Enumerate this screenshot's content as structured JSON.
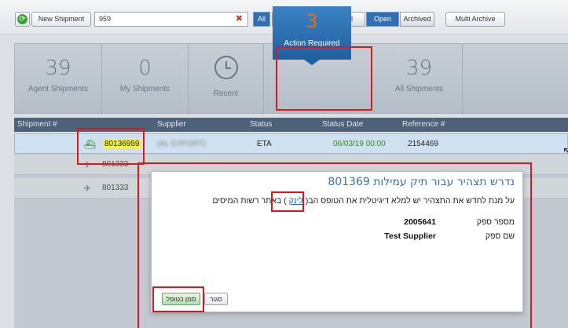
{
  "toolbar": {
    "refresh_icon": "refresh-icon",
    "new_shipment_label": "New Shipment",
    "search_value": "959",
    "clear_symbol": "✖",
    "filter_all_label": "All",
    "mode_icons": [
      "air-icon",
      "ship-icon",
      "truck-icon"
    ],
    "status_filters": [
      {
        "label": "All"
      },
      {
        "label": "Open",
        "active": true
      },
      {
        "label": "Archived"
      }
    ],
    "multi_archive_label": "Multi Archive",
    "accent_color": "#2f6fb2"
  },
  "stats": [
    {
      "value": "39",
      "label": "Agent Shipments"
    },
    {
      "value": "0",
      "label": "My Shipments"
    },
    {
      "value": "",
      "label": "Recent",
      "icon": "clock-icon"
    },
    {
      "value": "3",
      "label": "Action Required",
      "active": true,
      "value_color": "#e07020"
    },
    {
      "value": "39",
      "label": "All Shipments"
    }
  ],
  "grid": {
    "columns": [
      "Shipment #",
      "Supplier",
      "Status",
      "Status Date",
      "Reference #"
    ],
    "rows": [
      {
        "icon": "ship-icon",
        "shipment": "80136959",
        "supplier": "(AL EXPORT)",
        "status": "ETA",
        "status_date": "06/03/19 00:00",
        "reference": "2154469",
        "selected": true
      },
      {
        "icon": "airplane-icon",
        "shipment": "801333",
        "supplier": "",
        "status": "",
        "status_date": "",
        "reference": ""
      },
      {
        "icon": "airplane-icon",
        "shipment": "801333",
        "supplier": "",
        "status": "",
        "status_date": "",
        "reference": ""
      }
    ]
  },
  "dialog": {
    "title": "נדרש תצהיר עבור תיק עמילות",
    "file_number": "801369",
    "text_before_link": "על מנת לחדש את התצהיר יש למלא דיגיטלית את הטופס הב( ",
    "link_text": "לינק",
    "text_after_link": " ) באתר רשות המיסים",
    "fields": [
      {
        "label": "מספר ספק",
        "value": "2005641"
      },
      {
        "label": "שם ספק",
        "value": "Test Supplier"
      }
    ],
    "mark_done_label": "סמן כטופל",
    "close_label": "סגור"
  }
}
